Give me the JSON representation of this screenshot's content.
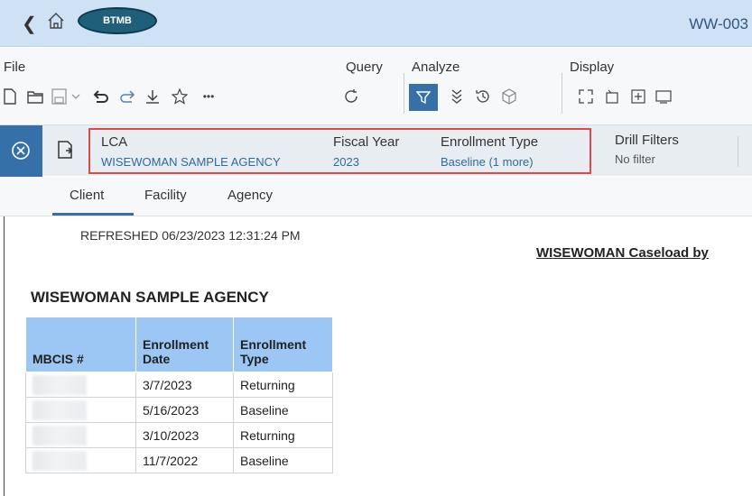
{
  "window": {
    "doc_title": "WW-003",
    "logo_text": "BTMB"
  },
  "toolbar": {
    "menus": [
      "File",
      "Query",
      "Analyze",
      "Display"
    ],
    "icons": [
      "new-document-icon",
      "open-folder-icon",
      "save-icon",
      "undo-icon",
      "redo-icon",
      "download-icon",
      "favorite-icon",
      "more-icon",
      "refresh-icon",
      "filter-icon",
      "drill-icon",
      "history-icon",
      "cube-icon",
      "fullscreen-icon",
      "pin-icon",
      "insert-icon",
      "present-icon"
    ],
    "active_color": "#3670a8"
  },
  "filters": {
    "lca_label": "LCA",
    "lca_value": "WISEWOMAN SAMPLE AGENCY",
    "fiscal_year_label": "Fiscal Year",
    "fiscal_year_value": "2023",
    "enrollment_type_label": "Enrollment Type",
    "enrollment_type_value": "Baseline (1 more)",
    "drill_label": "Drill Filters",
    "drill_value": "No filter",
    "highlight_color": "#e04949"
  },
  "tabs": [
    {
      "label": "Client",
      "active": true
    },
    {
      "label": "Facility",
      "active": false
    },
    {
      "label": "Agency",
      "active": false
    }
  ],
  "report": {
    "refreshed": "REFRESHED 06/23/2023 12:31:24 PM",
    "title": "WISEWOMAN Caseload by",
    "agency": "WISEWOMAN SAMPLE AGENCY",
    "columns": [
      "MBCIS #",
      "Enrollment Date",
      "Enrollment Type"
    ],
    "rows": [
      {
        "date": "3/7/2023",
        "type": "Returning"
      },
      {
        "date": "5/16/2023",
        "type": "Baseline"
      },
      {
        "date": "3/10/2023",
        "type": "Returning"
      },
      {
        "date": "11/7/2022",
        "type": "Baseline"
      }
    ]
  }
}
